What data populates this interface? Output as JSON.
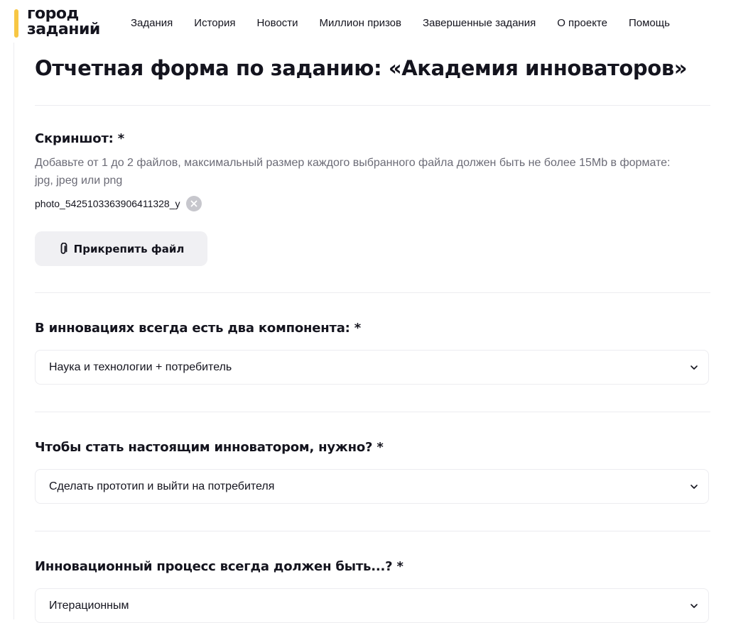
{
  "header": {
    "logo_line1": "город",
    "logo_line2": "заданий",
    "nav": [
      "Задания",
      "История",
      "Новости",
      "Миллион призов",
      "Завершенные задания",
      "О проекте",
      "Помощь"
    ]
  },
  "page": {
    "title": "Отчетная форма по заданию: «Академия инноваторов»"
  },
  "screenshot_field": {
    "label": "Скриншот:  *",
    "hint_line1": "Добавьте от 1 до 2 файлов, максимальный размер каждого выбранного файла должен быть не более 15Mb в формате:",
    "hint_line2": "jpg, jpeg или png",
    "file_name": "photo_5425103363906411328_y",
    "attach_label": "Прикрепить файл"
  },
  "questions": [
    {
      "label": "В инновациях всегда есть два компонента: *",
      "value": "Наука и технологии + потребитель"
    },
    {
      "label": "Чтобы стать настоящим инноватором, нужно? *",
      "value": "Сделать прототип и выйти на потребителя"
    },
    {
      "label": "Инновационный процесс всегда должен быть...? *",
      "value": "Итерационным"
    }
  ],
  "colors": {
    "accent": "#f7c744",
    "text": "#14141e",
    "muted": "#6b6b76",
    "button_bg": "#f0f0f3",
    "border": "#ececf0"
  },
  "icons": {
    "paperclip": "paperclip-icon",
    "remove": "close-circle-icon",
    "chevron": "chevron-down-icon"
  }
}
